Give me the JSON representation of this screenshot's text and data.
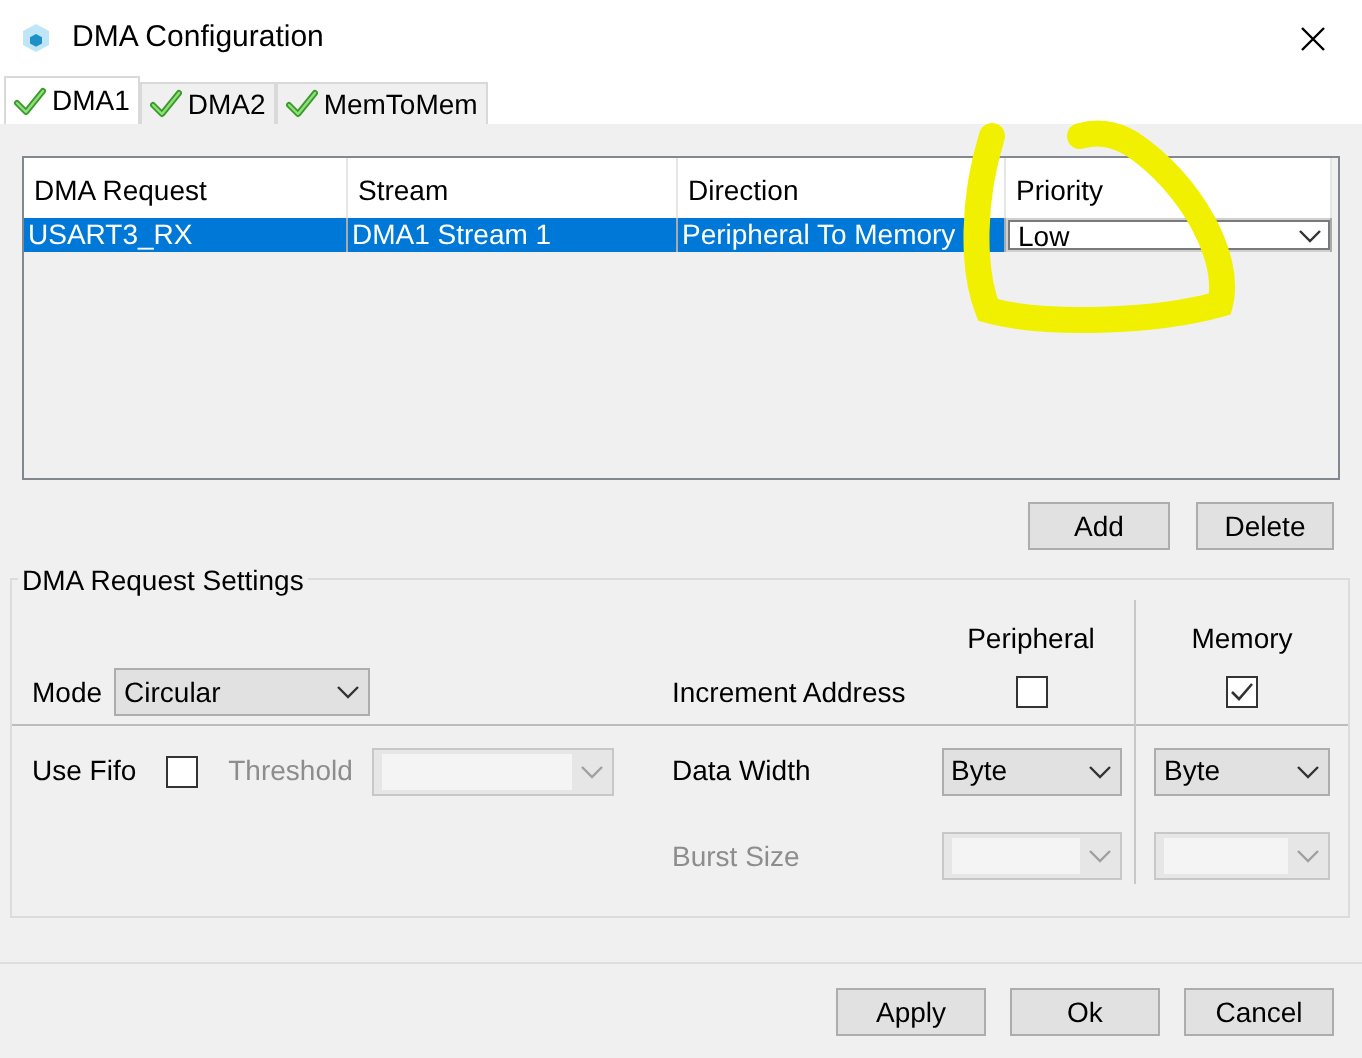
{
  "window": {
    "title": "DMA Configuration"
  },
  "tabs": [
    {
      "label": "DMA1",
      "selected": true
    },
    {
      "label": "DMA2",
      "selected": false
    },
    {
      "label": "MemToMem",
      "selected": false
    }
  ],
  "table": {
    "columns": [
      "DMA Request",
      "Stream",
      "Direction",
      "Priority"
    ],
    "rows": [
      {
        "cells": [
          "USART3_RX",
          "DMA1 Stream 1",
          "Peripheral To Memory"
        ],
        "priority": "Low",
        "selected": true
      }
    ]
  },
  "table_buttons": [
    "Add",
    "Delete"
  ],
  "settings": {
    "title": "DMA Request Settings",
    "column_headers": [
      "Peripheral",
      "Memory"
    ],
    "mode": {
      "label": "Mode",
      "value": "Circular"
    },
    "increment_address": {
      "label": "Increment Address",
      "peripheral": false,
      "memory": true
    },
    "use_fifo": {
      "label": "Use Fifo",
      "checked": false
    },
    "threshold": {
      "label": "Threshold",
      "disabled": true
    },
    "data_width": {
      "label": "Data Width",
      "peripheral": "Byte",
      "memory": "Byte"
    },
    "burst_size": {
      "label": "Burst Size",
      "disabled": true
    }
  },
  "buttons": [
    "Apply",
    "Ok",
    "Cancel"
  ]
}
